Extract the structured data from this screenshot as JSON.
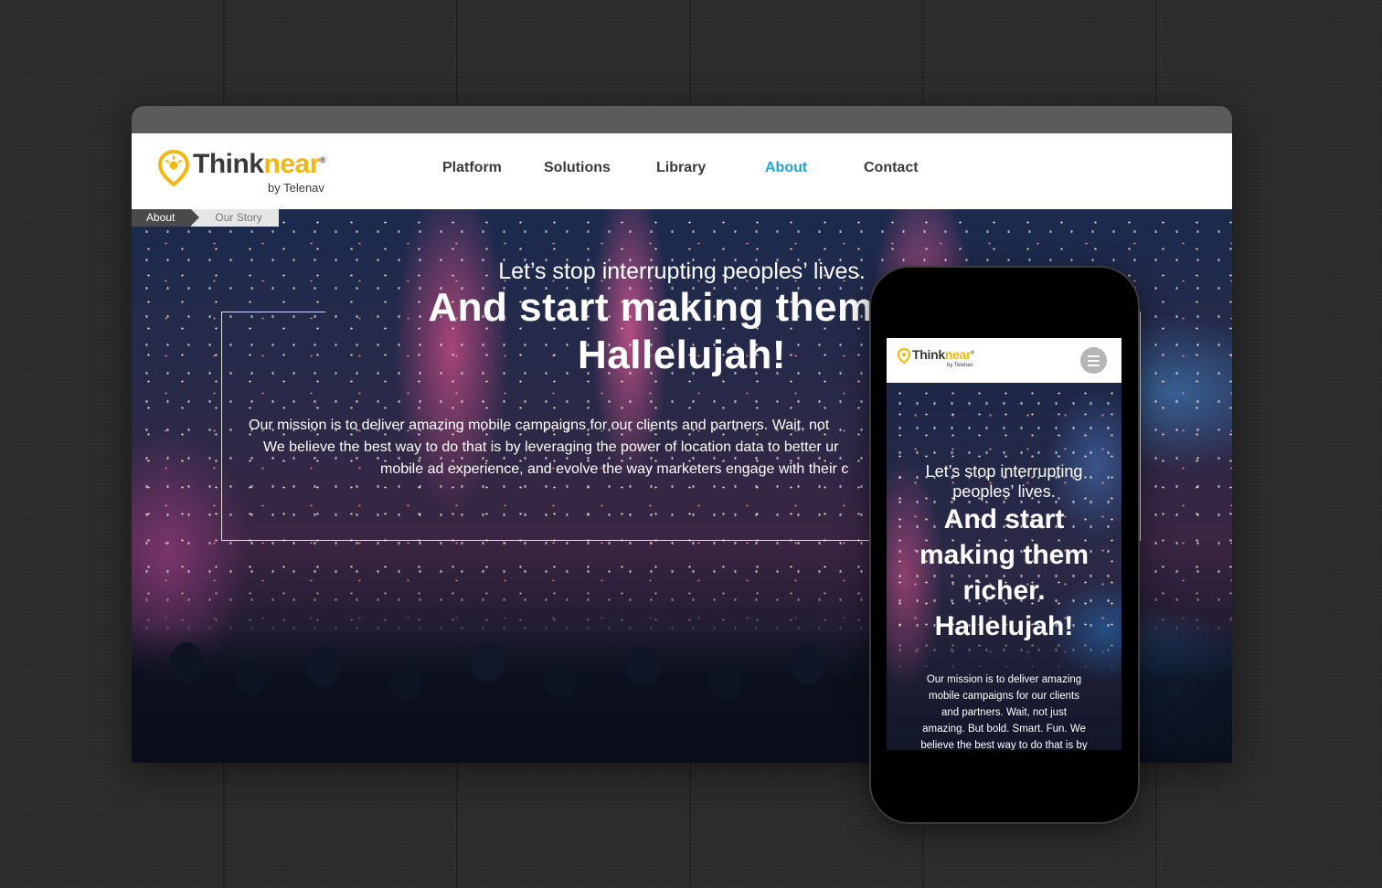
{
  "desktop": {
    "logo": {
      "think": "Think",
      "near": "near",
      "mark": "®",
      "by": "by Telenav"
    },
    "nav": [
      {
        "label": "Platform"
      },
      {
        "label": "Solutions"
      },
      {
        "label": "Library"
      },
      {
        "label": "About"
      },
      {
        "label": "Contact"
      }
    ],
    "active_nav": "About",
    "breadcrumb": [
      "About",
      "Our Story"
    ],
    "hero": {
      "subtitle": "Let’s stop interrupting peoples’ lives.",
      "title_line1": "And start making them ric",
      "title_line2": "Hallelujah!",
      "body_line1": "Our mission is to deliver amazing mobile campaigns for our clients and partners. Wait, not",
      "body_line2": "We believe the best way to do that is by leveraging the power of location data to better ur",
      "body_line3": "mobile ad experience, and evolve the way marketers engage with their c"
    }
  },
  "mobile": {
    "logo": {
      "think": "Think",
      "near": "near",
      "mark": "®",
      "by": "by Telenav"
    },
    "menu_icon": "hamburger-menu-icon",
    "hero": {
      "subtitle_line1": "Let’s stop interrupting",
      "subtitle_line2": "peoples’ lives.",
      "title_line1": "And start",
      "title_line2": "making them",
      "title_line3": "richer.",
      "title_line4": "Hallelujah!",
      "body_line1": "Our mission is to deliver amazing",
      "body_line2": "mobile campaigns for our clients",
      "body_line3": "and partners. Wait, not just",
      "body_line4": "amazing. But bold. Smart. Fun. We",
      "body_line5": "believe the best way to do that is by"
    }
  },
  "colors": {
    "brand_yellow": "#f2b70c",
    "nav_text": "#3a3a3a",
    "nav_active": "#1fa3cf",
    "page_bg": "#2b2b2b",
    "browser_bar": "#5b5b5b"
  }
}
